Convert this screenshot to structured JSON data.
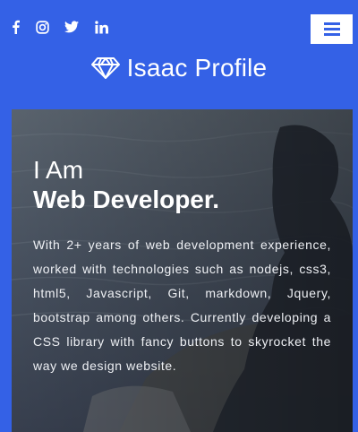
{
  "social": {
    "icons": [
      "facebook-icon",
      "instagram-icon",
      "twitter-icon",
      "linkedin-icon"
    ]
  },
  "menu": {
    "icon": "hamburger-icon"
  },
  "brand": {
    "icon": "diamond-icon",
    "name": "Isaac Profile"
  },
  "hero": {
    "title_line1": "I Am",
    "title_line2": "Web Developer.",
    "description": "With 2+ years of web development experience, worked with technologies such as nodejs, css3, html5, Javascript, Git, markdown, Jquery, bootstrap among others. Currently developing a CSS library with fancy buttons to skyrocket the way we design website."
  },
  "colors": {
    "brand_blue": "#3461e6",
    "white": "#ffffff"
  }
}
